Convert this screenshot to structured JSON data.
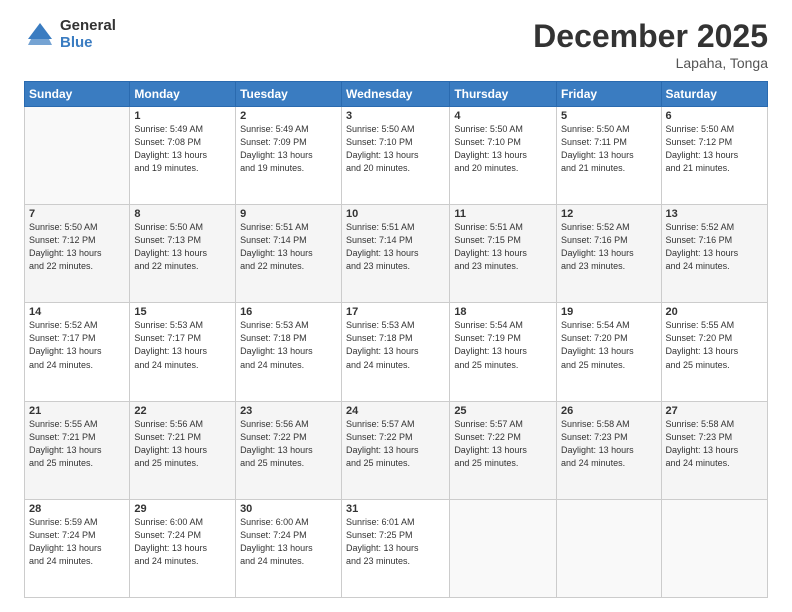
{
  "header": {
    "logo_general": "General",
    "logo_blue": "Blue",
    "month_title": "December 2025",
    "location": "Lapaha, Tonga"
  },
  "weekdays": [
    "Sunday",
    "Monday",
    "Tuesday",
    "Wednesday",
    "Thursday",
    "Friday",
    "Saturday"
  ],
  "weeks": [
    {
      "shade": false,
      "days": [
        {
          "num": "",
          "info": ""
        },
        {
          "num": "1",
          "info": "Sunrise: 5:49 AM\nSunset: 7:08 PM\nDaylight: 13 hours\nand 19 minutes."
        },
        {
          "num": "2",
          "info": "Sunrise: 5:49 AM\nSunset: 7:09 PM\nDaylight: 13 hours\nand 19 minutes."
        },
        {
          "num": "3",
          "info": "Sunrise: 5:50 AM\nSunset: 7:10 PM\nDaylight: 13 hours\nand 20 minutes."
        },
        {
          "num": "4",
          "info": "Sunrise: 5:50 AM\nSunset: 7:10 PM\nDaylight: 13 hours\nand 20 minutes."
        },
        {
          "num": "5",
          "info": "Sunrise: 5:50 AM\nSunset: 7:11 PM\nDaylight: 13 hours\nand 21 minutes."
        },
        {
          "num": "6",
          "info": "Sunrise: 5:50 AM\nSunset: 7:12 PM\nDaylight: 13 hours\nand 21 minutes."
        }
      ]
    },
    {
      "shade": true,
      "days": [
        {
          "num": "7",
          "info": "Sunrise: 5:50 AM\nSunset: 7:12 PM\nDaylight: 13 hours\nand 22 minutes."
        },
        {
          "num": "8",
          "info": "Sunrise: 5:50 AM\nSunset: 7:13 PM\nDaylight: 13 hours\nand 22 minutes."
        },
        {
          "num": "9",
          "info": "Sunrise: 5:51 AM\nSunset: 7:14 PM\nDaylight: 13 hours\nand 22 minutes."
        },
        {
          "num": "10",
          "info": "Sunrise: 5:51 AM\nSunset: 7:14 PM\nDaylight: 13 hours\nand 23 minutes."
        },
        {
          "num": "11",
          "info": "Sunrise: 5:51 AM\nSunset: 7:15 PM\nDaylight: 13 hours\nand 23 minutes."
        },
        {
          "num": "12",
          "info": "Sunrise: 5:52 AM\nSunset: 7:16 PM\nDaylight: 13 hours\nand 23 minutes."
        },
        {
          "num": "13",
          "info": "Sunrise: 5:52 AM\nSunset: 7:16 PM\nDaylight: 13 hours\nand 24 minutes."
        }
      ]
    },
    {
      "shade": false,
      "days": [
        {
          "num": "14",
          "info": "Sunrise: 5:52 AM\nSunset: 7:17 PM\nDaylight: 13 hours\nand 24 minutes."
        },
        {
          "num": "15",
          "info": "Sunrise: 5:53 AM\nSunset: 7:17 PM\nDaylight: 13 hours\nand 24 minutes."
        },
        {
          "num": "16",
          "info": "Sunrise: 5:53 AM\nSunset: 7:18 PM\nDaylight: 13 hours\nand 24 minutes."
        },
        {
          "num": "17",
          "info": "Sunrise: 5:53 AM\nSunset: 7:18 PM\nDaylight: 13 hours\nand 24 minutes."
        },
        {
          "num": "18",
          "info": "Sunrise: 5:54 AM\nSunset: 7:19 PM\nDaylight: 13 hours\nand 25 minutes."
        },
        {
          "num": "19",
          "info": "Sunrise: 5:54 AM\nSunset: 7:20 PM\nDaylight: 13 hours\nand 25 minutes."
        },
        {
          "num": "20",
          "info": "Sunrise: 5:55 AM\nSunset: 7:20 PM\nDaylight: 13 hours\nand 25 minutes."
        }
      ]
    },
    {
      "shade": true,
      "days": [
        {
          "num": "21",
          "info": "Sunrise: 5:55 AM\nSunset: 7:21 PM\nDaylight: 13 hours\nand 25 minutes."
        },
        {
          "num": "22",
          "info": "Sunrise: 5:56 AM\nSunset: 7:21 PM\nDaylight: 13 hours\nand 25 minutes."
        },
        {
          "num": "23",
          "info": "Sunrise: 5:56 AM\nSunset: 7:22 PM\nDaylight: 13 hours\nand 25 minutes."
        },
        {
          "num": "24",
          "info": "Sunrise: 5:57 AM\nSunset: 7:22 PM\nDaylight: 13 hours\nand 25 minutes."
        },
        {
          "num": "25",
          "info": "Sunrise: 5:57 AM\nSunset: 7:22 PM\nDaylight: 13 hours\nand 25 minutes."
        },
        {
          "num": "26",
          "info": "Sunrise: 5:58 AM\nSunset: 7:23 PM\nDaylight: 13 hours\nand 24 minutes."
        },
        {
          "num": "27",
          "info": "Sunrise: 5:58 AM\nSunset: 7:23 PM\nDaylight: 13 hours\nand 24 minutes."
        }
      ]
    },
    {
      "shade": false,
      "days": [
        {
          "num": "28",
          "info": "Sunrise: 5:59 AM\nSunset: 7:24 PM\nDaylight: 13 hours\nand 24 minutes."
        },
        {
          "num": "29",
          "info": "Sunrise: 6:00 AM\nSunset: 7:24 PM\nDaylight: 13 hours\nand 24 minutes."
        },
        {
          "num": "30",
          "info": "Sunrise: 6:00 AM\nSunset: 7:24 PM\nDaylight: 13 hours\nand 24 minutes."
        },
        {
          "num": "31",
          "info": "Sunrise: 6:01 AM\nSunset: 7:25 PM\nDaylight: 13 hours\nand 23 minutes."
        },
        {
          "num": "",
          "info": ""
        },
        {
          "num": "",
          "info": ""
        },
        {
          "num": "",
          "info": ""
        }
      ]
    }
  ]
}
